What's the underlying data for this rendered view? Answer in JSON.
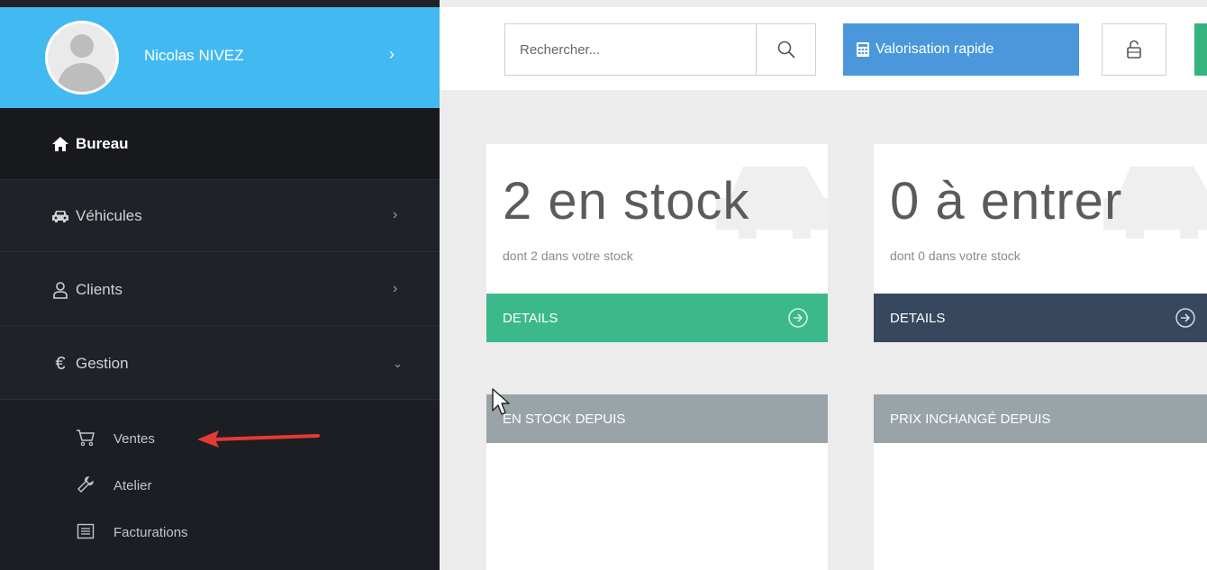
{
  "user": {
    "name": "Nicolas NIVEZ"
  },
  "sidebar": {
    "items": [
      {
        "label": "Bureau",
        "icon": "home-icon",
        "active": true
      },
      {
        "label": "Véhicules",
        "icon": "car-icon"
      },
      {
        "label": "Clients",
        "icon": "user-icon"
      },
      {
        "label": "Gestion",
        "icon": "euro-icon",
        "expanded": true
      }
    ],
    "submenu": [
      {
        "label": "Ventes",
        "icon": "cart-icon"
      },
      {
        "label": "Atelier",
        "icon": "wrench-icon"
      },
      {
        "label": "Facturations",
        "icon": "invoice-icon"
      }
    ]
  },
  "topbar": {
    "search_placeholder": "Rechercher...",
    "valorisation_label": "Valorisation rapide"
  },
  "cards": [
    {
      "title": "2 en stock",
      "subtitle": "dont 2 dans votre stock",
      "details_label": "DETAILS"
    },
    {
      "title": "0 à entrer",
      "subtitle": "dont 0 dans votre stock",
      "details_label": "DETAILS"
    }
  ],
  "sections": [
    {
      "label": "EN STOCK DEPUIS"
    },
    {
      "label": "PRIX INCHANGÉ DEPUIS"
    }
  ],
  "colors": {
    "sidebar_bg": "#1f2327",
    "profile_bg": "#42b9f0",
    "valorisation_bg": "#4a98db",
    "details_green": "#3bb98b",
    "details_dark": "#36475e",
    "section_bar": "#9aa4a8",
    "annotation_arrow": "#e53935"
  }
}
